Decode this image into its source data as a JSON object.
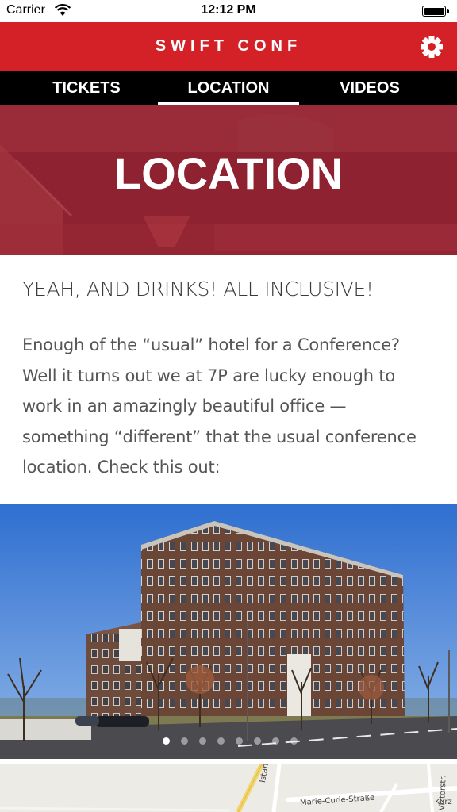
{
  "status_bar": {
    "carrier": "Carrier",
    "time": "12:12 PM",
    "icons": [
      "wifi-icon",
      "battery-icon"
    ]
  },
  "header": {
    "title": "SWIFT CONF",
    "settings_icon": "gear-icon",
    "background_color": "#d42027"
  },
  "tabs": [
    {
      "label": "TICKETS",
      "selected": false
    },
    {
      "label": "LOCATION",
      "selected": true
    },
    {
      "label": "VIDEOS",
      "selected": false
    }
  ],
  "hero": {
    "title": "LOCATION"
  },
  "content": {
    "heading": "YEAH, AND DRINKS! ALL INCLUSIVE!",
    "paragraph_lines": [
      "Enough of the “usual” hotel for a Conference?",
      "Well it turns out we at 7P are lucky enough to",
      "work in an amazingly beautiful office —",
      "something “different” that the usual conference",
      "location. Check this out:"
    ]
  },
  "carousel": {
    "page_count": 8,
    "current_page": 1
  },
  "map": {
    "street_labels": [
      "Istanbulstr.",
      "Marie-Curie-Straße",
      "Viktorstr.",
      "Kurz"
    ]
  },
  "colors": {
    "brand_red": "#d42027",
    "tab_bar": "#000000",
    "hero_overlay": "#8e2230",
    "text": "#555555"
  }
}
